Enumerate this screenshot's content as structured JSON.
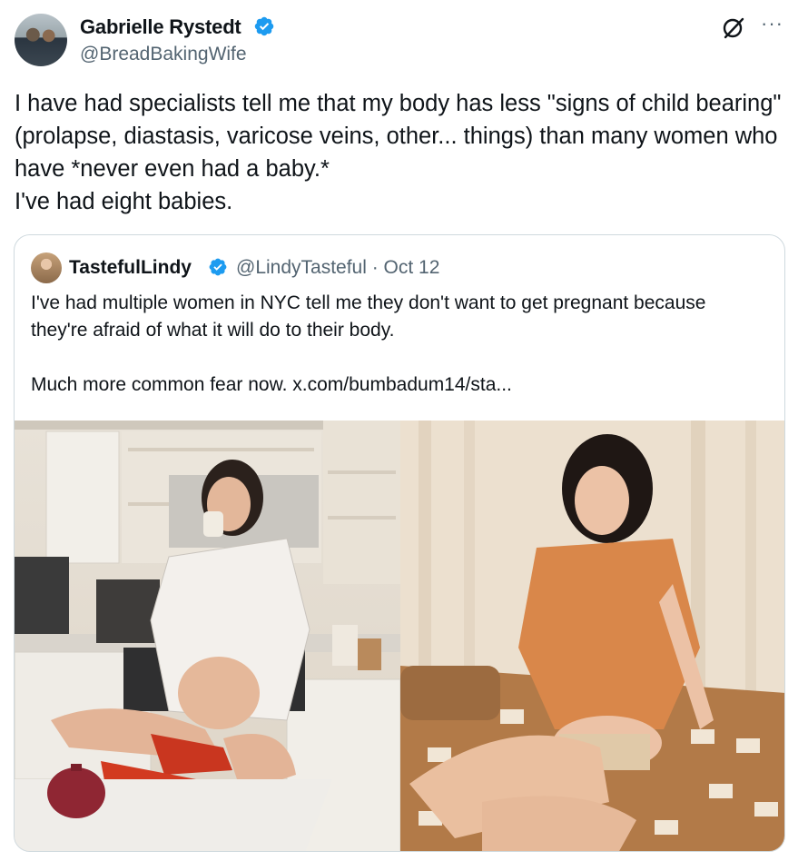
{
  "tweet": {
    "author_name": "Gabrielle Rystedt",
    "author_handle": "@BreadBakingWife",
    "text": "I have had specialists tell me that my body has less \"signs of child bearing\" (prolapse, diastasis, varicose veins, other... things) than many women who have *never even had a baby.*\nI've had eight babies.",
    "more_label": "···"
  },
  "quote": {
    "author_name": "TastefulLindy",
    "meta": "@LindyTasteful · Oct 12",
    "text": "I've had multiple women in NYC tell me they don't want to get pregnant because they're afraid of what it will do to their body.\n\nMuch more common fear now.  x.com/bumbadum14/sta..."
  },
  "colors": {
    "verified": "#1d9bf0",
    "secondary_text": "#536471",
    "border": "#cfd9de"
  },
  "icons": [
    "verified-badge-icon",
    "grok-icon",
    "more-icon"
  ]
}
